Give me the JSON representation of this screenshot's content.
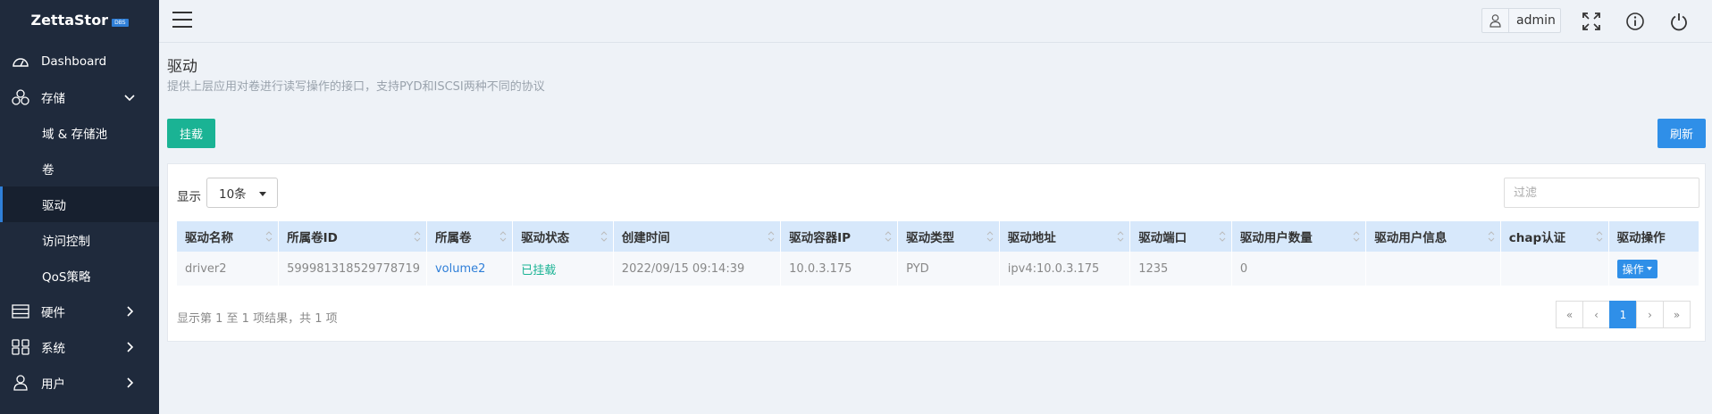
{
  "app": {
    "logo_text": "ZettaStor",
    "logo_badge": "DBS"
  },
  "sidebar": {
    "items": [
      {
        "label": "Dashboard",
        "icon": "dashboard-gauge-icon"
      },
      {
        "label": "存储",
        "icon": "storage-cluster-icon",
        "expanded": true
      },
      {
        "label": "硬件",
        "icon": "hardware-server-icon"
      },
      {
        "label": "系统",
        "icon": "system-grid-icon"
      },
      {
        "label": "用户",
        "icon": "user-icon"
      }
    ],
    "sub_items": [
      {
        "label": "域 & 存储池"
      },
      {
        "label": "卷"
      },
      {
        "label": "驱动",
        "active": true
      },
      {
        "label": "访问控制"
      },
      {
        "label": "QoS策略"
      }
    ]
  },
  "header": {
    "user": "admin"
  },
  "page": {
    "title": "驱动",
    "subtitle": "提供上层应用对卷进行读写操作的接口，支持PYD和ISCSI两种不同的协议",
    "mount_button": "挂载",
    "refresh_button": "刷新"
  },
  "table_controls": {
    "show_label": "显示",
    "page_size": "10条",
    "filter_placeholder": "过滤"
  },
  "table": {
    "columns": [
      "驱动名称",
      "所属卷ID",
      "所属卷",
      "驱动状态",
      "创建时间",
      "驱动容器IP",
      "驱动类型",
      "驱动地址",
      "驱动端口",
      "驱动用户数量",
      "驱动用户信息",
      "chap认证",
      "驱动操作"
    ],
    "rows": [
      {
        "name": "driver2",
        "volume_id": "599981318529778719",
        "volume": "volume2",
        "status": "已挂载",
        "created": "2022/09/15 09:14:39",
        "container_ip": "10.0.3.175",
        "type": "PYD",
        "address": "ipv4:10.0.3.175",
        "port": "1235",
        "user_count": "0",
        "user_info": "",
        "chap": "",
        "action": "操作"
      }
    ]
  },
  "footer": {
    "info": "显示第 1 至 1 项结果，共 1 项",
    "pages": {
      "first": "«",
      "prev": "‹",
      "current": "1",
      "next": "›",
      "last": "»"
    }
  },
  "colors": {
    "sidebar_bg": "#1f2a3c",
    "primary": "#2f8fe8",
    "success": "#1ab394",
    "header_row": "#d7e8fb"
  }
}
